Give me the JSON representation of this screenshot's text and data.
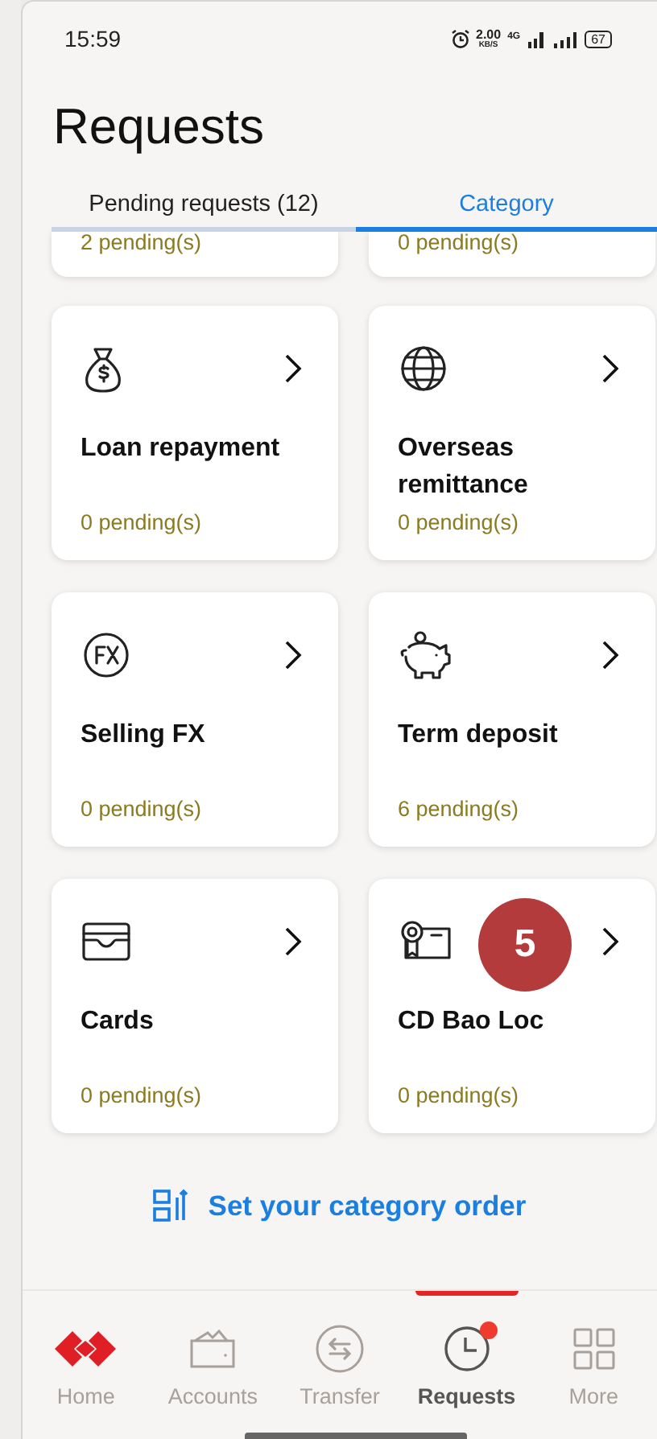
{
  "status_bar": {
    "time": "15:59",
    "speed": "2.00",
    "speed_unit": "KB/S",
    "network": "4G",
    "battery": "67"
  },
  "title": "Requests",
  "tabs": [
    {
      "label": "Pending requests (12)",
      "selected": false
    },
    {
      "label": "Category",
      "selected": true
    }
  ],
  "partial_cards": [
    {
      "pending": "2 pending(s)"
    },
    {
      "pending": "0 pending(s)"
    }
  ],
  "cards": [
    {
      "title": "Loan repayment",
      "pending": "0 pending(s)"
    },
    {
      "title": "Overseas remittance",
      "pending": "0 pending(s)"
    },
    {
      "title": "Selling FX",
      "pending": "0 pending(s)"
    },
    {
      "title": "Term deposit",
      "pending": "6 pending(s)"
    },
    {
      "title": "Cards",
      "pending": "0 pending(s)"
    },
    {
      "title": "CD Bao Loc",
      "pending": "0 pending(s)"
    }
  ],
  "step_marker": "5",
  "order_link": "Set your category order",
  "nav": [
    {
      "label": "Home",
      "selected": false,
      "notification": false
    },
    {
      "label": "Accounts",
      "selected": false,
      "notification": false
    },
    {
      "label": "Transfer",
      "selected": false,
      "notification": false
    },
    {
      "label": "Requests",
      "selected": true,
      "notification": true
    },
    {
      "label": "More",
      "selected": false,
      "notification": false
    }
  ]
}
